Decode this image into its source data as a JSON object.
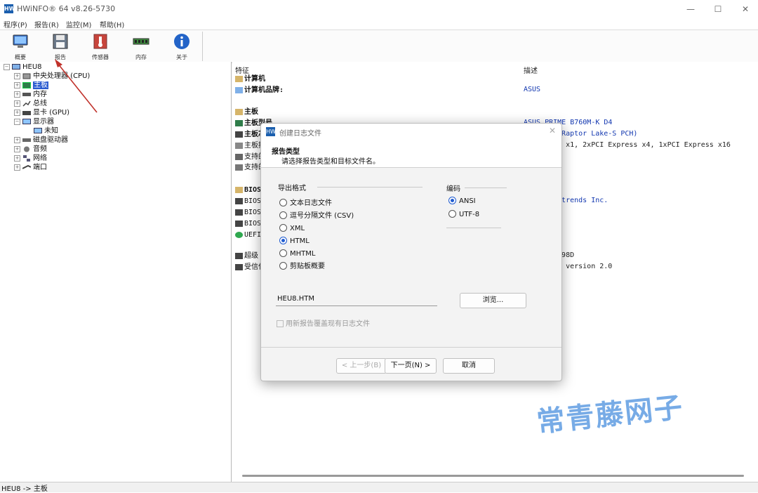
{
  "window": {
    "title": "HWiNFO® 64 v8.26-5730"
  },
  "menu": [
    "程序(P)",
    "报告(R)",
    "监控(M)",
    "帮助(H)"
  ],
  "toolbar": [
    {
      "label": "概要",
      "icon": "monitor-icon"
    },
    {
      "label": "报告",
      "icon": "floppy-disk-icon"
    },
    {
      "label": "传感器",
      "icon": "thermometer-icon"
    },
    {
      "label": "内存",
      "icon": "memory-module-icon"
    },
    {
      "label": "关于",
      "icon": "info-icon"
    }
  ],
  "tree": {
    "root": "HEU8",
    "items": [
      {
        "label": "中央处理器 (CPU)",
        "icon": "cpu-icon"
      },
      {
        "label": "主板",
        "icon": "motherboard-icon",
        "selected": true
      },
      {
        "label": "内存",
        "icon": "memory-icon"
      },
      {
        "label": "总线",
        "icon": "bus-icon"
      },
      {
        "label": "显卡 (GPU)",
        "icon": "gpu-icon"
      },
      {
        "label": "显示器",
        "icon": "display-icon"
      },
      {
        "label": "未知",
        "icon": "display-icon"
      },
      {
        "label": "磁盘驱动器",
        "icon": "disk-icon"
      },
      {
        "label": "音频",
        "icon": "audio-icon"
      },
      {
        "label": "网络",
        "icon": "network-icon"
      },
      {
        "label": "端口",
        "icon": "port-icon"
      }
    ]
  },
  "details": {
    "col_feature": "特征",
    "col_desc": "描述",
    "rows": [
      {
        "label": "计算机",
        "bold": true,
        "icon": "folder-icon",
        "value": ""
      },
      {
        "label": "计算机品牌:",
        "bold": true,
        "icon": "computer-icon",
        "value": "ASUS"
      },
      {
        "label": "主板",
        "bold": true,
        "icon": "folder-icon",
        "value": ""
      },
      {
        "label": "主板型号",
        "bold": true,
        "icon": "motherboard-icon",
        "value": "ASUS PRIME B760M-K D4"
      },
      {
        "label": "主板芯",
        "bold": true,
        "icon": "chip-icon",
        "value": "0 (Raptor Lake-S PCH)"
      },
      {
        "label": "主板插",
        "bold": false,
        "icon": "slot-icon",
        "value": "ess x1, 2xPCI Express x4, 1xPCI Express x16"
      },
      {
        "label": "支持的",
        "bold": false,
        "icon": "memory-icon",
        "value": ""
      },
      {
        "label": "支持的",
        "bold": false,
        "icon": "bus-icon",
        "value": ""
      },
      {
        "label": "BIOS",
        "bold": true,
        "icon": "folder-icon",
        "value": ""
      },
      {
        "label": "BIOS",
        "bold": false,
        "icon": "chip-icon",
        "value": "agatrends Inc."
      },
      {
        "label": "BIOS",
        "bold": false,
        "icon": "chip-icon",
        "value": ""
      },
      {
        "label": "BIOS",
        "bold": false,
        "icon": "chip-icon",
        "value": ""
      },
      {
        "label": "UEFI",
        "bold": false,
        "icon": "check-icon",
        "value": ""
      },
      {
        "label": "超级",
        "bold": false,
        "icon": "chip-icon",
        "value": "T6798D"
      },
      {
        "label": "受信任",
        "bold": false,
        "icon": "chip-icon",
        "value": "PM, version 2.0"
      }
    ]
  },
  "status": "HEU8 -> 主板",
  "dialog": {
    "title": "创建日志文件",
    "header_title": "报告类型",
    "header_subtitle": "请选择报告类型和目标文件名。",
    "export_format_label": "导出格式",
    "formats": [
      {
        "label": "文本日志文件",
        "checked": false
      },
      {
        "label": "逗号分隔文件 (CSV)",
        "checked": false
      },
      {
        "label": "XML",
        "checked": false
      },
      {
        "label": "HTML",
        "checked": true
      },
      {
        "label": "MHTML",
        "checked": false
      },
      {
        "label": "剪贴板概要",
        "checked": false
      }
    ],
    "encoding_label": "编码",
    "encodings": [
      {
        "label": "ANSI",
        "checked": true
      },
      {
        "label": "UTF-8",
        "checked": false
      }
    ],
    "filename": "HEU8.HTM",
    "browse_label": "浏览...",
    "overwrite_label": "用新报告覆盖现有日志文件",
    "back_label": "< 上一步(B)",
    "next_label": "下一页(N) >",
    "cancel_label": "取消"
  },
  "watermark": "常青藤网子"
}
